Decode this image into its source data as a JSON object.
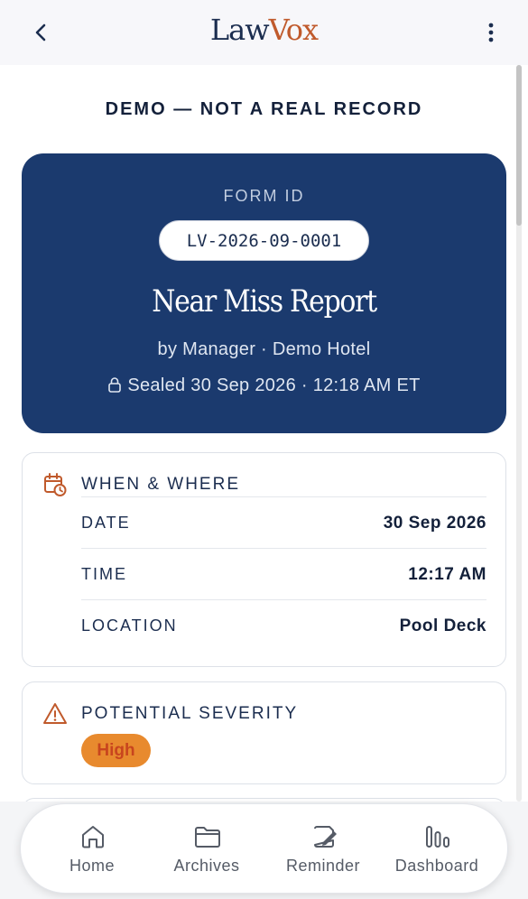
{
  "header": {
    "logo_part1": "Law",
    "logo_part2": "Vox"
  },
  "banner": "DEMO — NOT A REAL RECORD",
  "record": {
    "form_id_label": "FORM ID",
    "form_id": "LV-2026-09-0001",
    "title": "Near Miss Report",
    "byline": "by Manager · Demo Hotel",
    "sealed": "Sealed 30 Sep 2026 · 12:18 AM ET"
  },
  "when_where": {
    "title": "WHEN & WHERE",
    "icon": "calendar-clock-icon",
    "rows": [
      {
        "label": "DATE",
        "value": "30 Sep 2026"
      },
      {
        "label": "TIME",
        "value": "12:17 AM"
      },
      {
        "label": "LOCATION",
        "value": "Pool Deck"
      }
    ]
  },
  "severity": {
    "title": "POTENTIAL SEVERITY",
    "icon": "warning-icon",
    "value": "High"
  },
  "nav": [
    {
      "label": "Home",
      "icon": "home-icon"
    },
    {
      "label": "Archives",
      "icon": "folder-icon"
    },
    {
      "label": "Reminder",
      "icon": "note-edit-icon"
    },
    {
      "label": "Dashboard",
      "icon": "bar-chart-icon"
    }
  ],
  "colors": {
    "navy": "#1b3a6e",
    "accent": "#c05a2c",
    "severity_badge": "#e88a2e"
  }
}
